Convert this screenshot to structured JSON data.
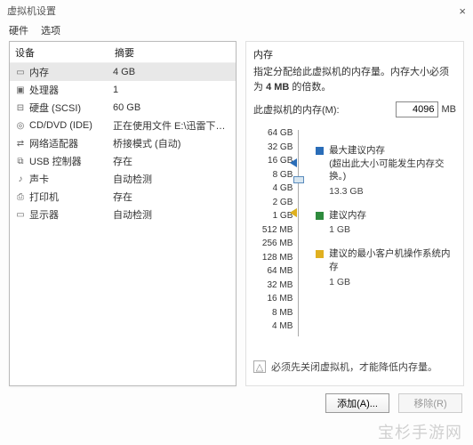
{
  "window": {
    "title": "虚拟机设置",
    "close": "×"
  },
  "tabs": {
    "hardware": "硬件",
    "options": "选项"
  },
  "leftHeader": {
    "device": "设备",
    "summary": "摘要"
  },
  "devices": [
    {
      "icon": "▭",
      "name": "内存",
      "summary": "4 GB"
    },
    {
      "icon": "▣",
      "name": "处理器",
      "summary": "1"
    },
    {
      "icon": "⊟",
      "name": "硬盘 (SCSI)",
      "summary": "60 GB"
    },
    {
      "icon": "◎",
      "name": "CD/DVD (IDE)",
      "summary": "正在使用文件 E:\\迅雷下载\\cn_..."
    },
    {
      "icon": "⇄",
      "name": "网络适配器",
      "summary": "桥接模式 (自动)"
    },
    {
      "icon": "⧉",
      "name": "USB 控制器",
      "summary": "存在"
    },
    {
      "icon": "♪",
      "name": "声卡",
      "summary": "自动检测"
    },
    {
      "icon": "⎙",
      "name": "打印机",
      "summary": "存在"
    },
    {
      "icon": "▭",
      "name": "显示器",
      "summary": "自动检测"
    }
  ],
  "right": {
    "title": "内存",
    "desc_a": "指定分配给此虚拟机的内存量。内存大小必须为 ",
    "desc_b": "4 MB",
    "desc_c": " 的倍数。",
    "mem_label": "此虚拟机的内存(M):",
    "mem_value": "4096",
    "mem_unit": "MB",
    "ticks": [
      "64 GB",
      "32 GB",
      "16 GB",
      "8 GB",
      "4 GB",
      "2 GB",
      "1 GB",
      "512 MB",
      "256 MB",
      "128 MB",
      "64 MB",
      "32 MB",
      "16 MB",
      "8 MB",
      "4 MB"
    ],
    "legend": {
      "max_label": "最大建议内存",
      "max_note": "(超出此大小可能发生内存交换。)",
      "max_val": "13.3 GB",
      "rec_label": "建议内存",
      "rec_val": "1 GB",
      "min_label": "建议的最小客户机操作系统内存",
      "min_val": "1 GB"
    },
    "warning": "必须先关闭虚拟机，才能降低内存量。",
    "warn_icon": "△"
  },
  "buttons": {
    "add": "添加(A)...",
    "remove": "移除(R)"
  },
  "watermark": "宝杉手游网"
}
